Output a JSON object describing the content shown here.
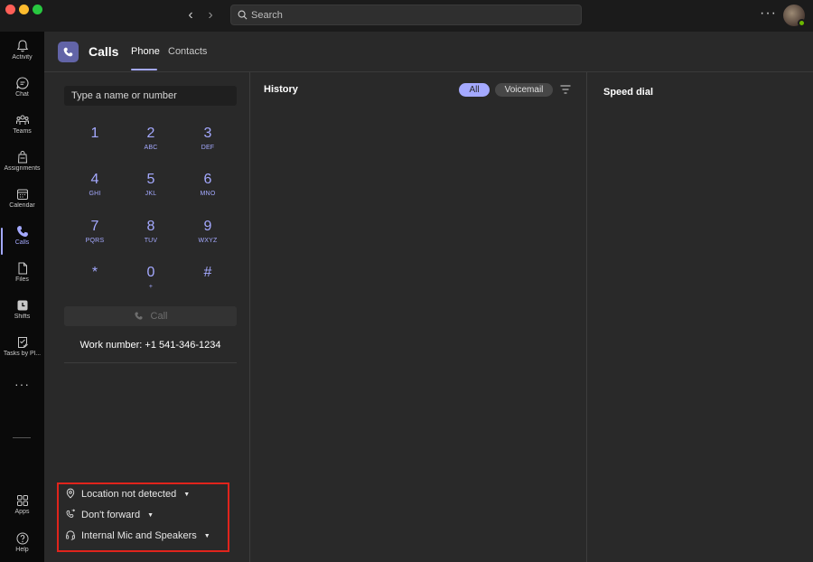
{
  "search": {
    "placeholder": "Search"
  },
  "rail": {
    "items": [
      {
        "label": "Activity"
      },
      {
        "label": "Chat"
      },
      {
        "label": "Teams"
      },
      {
        "label": "Assignments"
      },
      {
        "label": "Calendar"
      },
      {
        "label": "Calls"
      },
      {
        "label": "Files"
      },
      {
        "label": "Shifts"
      },
      {
        "label": "Tasks by Pl..."
      },
      {
        "label": ""
      },
      {
        "label": "Apps"
      },
      {
        "label": "Help"
      }
    ],
    "more": "···"
  },
  "header": {
    "title": "Calls",
    "tabs": [
      {
        "label": "Phone"
      },
      {
        "label": "Contacts"
      }
    ]
  },
  "dialer": {
    "input_placeholder": "Type a name or number",
    "keys": [
      {
        "digit": "1",
        "letters": ""
      },
      {
        "digit": "2",
        "letters": "ABC"
      },
      {
        "digit": "3",
        "letters": "DEF"
      },
      {
        "digit": "4",
        "letters": "GHI"
      },
      {
        "digit": "5",
        "letters": "JKL"
      },
      {
        "digit": "6",
        "letters": "MNO"
      },
      {
        "digit": "7",
        "letters": "PQRS"
      },
      {
        "digit": "8",
        "letters": "TUV"
      },
      {
        "digit": "9",
        "letters": "WXYZ"
      },
      {
        "digit": "*",
        "letters": ""
      },
      {
        "digit": "0",
        "letters": "+"
      },
      {
        "digit": "#",
        "letters": ""
      }
    ],
    "call_label": "Call",
    "work_number": "Work number: +1 541-346-1234"
  },
  "settings": {
    "location": "Location not detected",
    "forward": "Don't forward",
    "device": "Internal Mic and Speakers"
  },
  "history": {
    "title": "History",
    "filters": [
      {
        "label": "All"
      },
      {
        "label": "Voicemail"
      }
    ]
  },
  "speed_dial": {
    "title": "Speed dial"
  },
  "colors": {
    "accent": "#a4a9ff",
    "brand": "#6264a7",
    "highlight_box": "#e0241c",
    "presence_available": "#6bb700"
  }
}
